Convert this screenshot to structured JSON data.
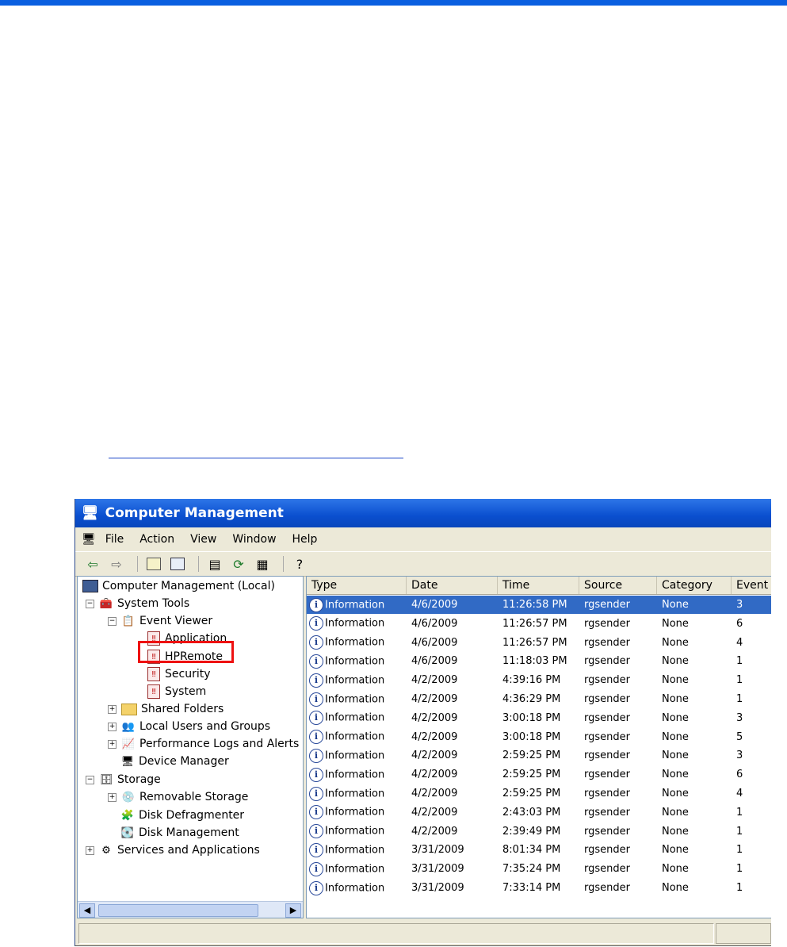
{
  "window": {
    "title": "Computer Management"
  },
  "menu": [
    "File",
    "Action",
    "View",
    "Window",
    "Help"
  ],
  "tree": [
    {
      "label": "Computer Management (Local)",
      "icon": "computer-icon"
    },
    {
      "label": "System Tools",
      "icon": "tools-icon"
    },
    {
      "label": "Event Viewer",
      "icon": "event-viewer-icon"
    },
    {
      "label": "Application",
      "icon": "event-log-icon"
    },
    {
      "label": "HPRemote",
      "icon": "event-log-icon"
    },
    {
      "label": "Security",
      "icon": "event-log-icon"
    },
    {
      "label": "System",
      "icon": "event-log-icon"
    },
    {
      "label": "Shared Folders",
      "icon": "folder-icon"
    },
    {
      "label": "Local Users and Groups",
      "icon": "users-icon"
    },
    {
      "label": "Performance Logs and Alerts",
      "icon": "performance-icon"
    },
    {
      "label": "Device Manager",
      "icon": "device-manager-icon"
    },
    {
      "label": "Storage",
      "icon": "storage-icon"
    },
    {
      "label": "Removable Storage",
      "icon": "removable-storage-icon"
    },
    {
      "label": "Disk Defragmenter",
      "icon": "defrag-icon"
    },
    {
      "label": "Disk Management",
      "icon": "disk-management-icon"
    },
    {
      "label": "Services and Applications",
      "icon": "services-icon"
    }
  ],
  "list": {
    "columns": [
      "Type",
      "Date",
      "Time",
      "Source",
      "Category",
      "Event"
    ],
    "rows": [
      [
        "Information",
        "4/6/2009",
        "11:26:58 PM",
        "rgsender",
        "None",
        "3"
      ],
      [
        "Information",
        "4/6/2009",
        "11:26:57 PM",
        "rgsender",
        "None",
        "6"
      ],
      [
        "Information",
        "4/6/2009",
        "11:26:57 PM",
        "rgsender",
        "None",
        "4"
      ],
      [
        "Information",
        "4/6/2009",
        "11:18:03 PM",
        "rgsender",
        "None",
        "1"
      ],
      [
        "Information",
        "4/2/2009",
        "4:39:16 PM",
        "rgsender",
        "None",
        "1"
      ],
      [
        "Information",
        "4/2/2009",
        "4:36:29 PM",
        "rgsender",
        "None",
        "1"
      ],
      [
        "Information",
        "4/2/2009",
        "3:00:18 PM",
        "rgsender",
        "None",
        "3"
      ],
      [
        "Information",
        "4/2/2009",
        "3:00:18 PM",
        "rgsender",
        "None",
        "5"
      ],
      [
        "Information",
        "4/2/2009",
        "2:59:25 PM",
        "rgsender",
        "None",
        "3"
      ],
      [
        "Information",
        "4/2/2009",
        "2:59:25 PM",
        "rgsender",
        "None",
        "6"
      ],
      [
        "Information",
        "4/2/2009",
        "2:59:25 PM",
        "rgsender",
        "None",
        "4"
      ],
      [
        "Information",
        "4/2/2009",
        "2:43:03 PM",
        "rgsender",
        "None",
        "1"
      ],
      [
        "Information",
        "4/2/2009",
        "2:39:49 PM",
        "rgsender",
        "None",
        "1"
      ],
      [
        "Information",
        "3/31/2009",
        "8:01:34 PM",
        "rgsender",
        "None",
        "1"
      ],
      [
        "Information",
        "3/31/2009",
        "7:35:24 PM",
        "rgsender",
        "None",
        "1"
      ],
      [
        "Information",
        "3/31/2009",
        "7:33:14 PM",
        "rgsender",
        "None",
        "1"
      ]
    ]
  },
  "colors": {
    "selection": "#316ac5",
    "titlebar": "#0a4fcf",
    "highlight_box": "#e11111",
    "top_rule": "#0a5fe0"
  }
}
